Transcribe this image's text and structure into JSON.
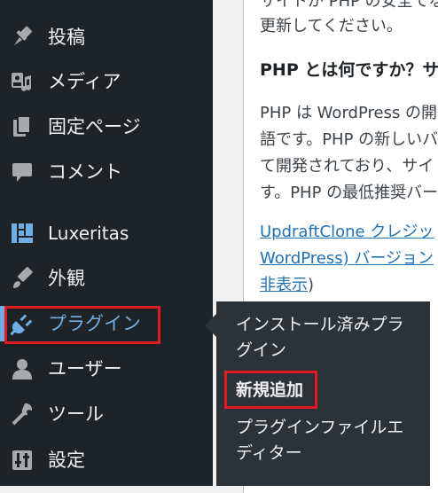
{
  "sidebar": {
    "items": [
      {
        "label": "投稿",
        "icon": "pushpin-icon"
      },
      {
        "label": "メディア",
        "icon": "media-icon"
      },
      {
        "label": "固定ページ",
        "icon": "pages-icon"
      },
      {
        "label": "コメント",
        "icon": "comment-icon"
      },
      {
        "label": "Luxeritas",
        "icon": "luxeritas-icon"
      },
      {
        "label": "外観",
        "icon": "paintbrush-icon"
      },
      {
        "label": "プラグイン",
        "icon": "plugin-icon",
        "active": true
      },
      {
        "label": "ユーザー",
        "icon": "user-icon"
      },
      {
        "label": "ツール",
        "icon": "wrench-icon"
      },
      {
        "label": "設定",
        "icon": "settings-icon"
      }
    ]
  },
  "submenu": {
    "installed": [
      "インストール済みプラ",
      "グイン"
    ],
    "add_new": "新規追加",
    "editor": [
      "プラグインファイルエ",
      "ディター"
    ]
  },
  "main": {
    "lines": [
      "サイトが PHP の安全でな",
      "更新してください。",
      "PHP とは何ですか？サ",
      "PHP は WordPress の開",
      "語です。PHP の新しいバ",
      "て開発されており、サイ",
      "す。PHP の最低推奨バー"
    ],
    "link_lines": [
      "UpdraftClone クレジッ",
      "WordPress) バージョン"
    ],
    "hide_link": "非表示",
    "hide_suffix": ")"
  },
  "colors": {
    "sidebar_bg": "#1d2327",
    "submenu_bg": "#2c3338",
    "active": "#72aee6",
    "highlight_box": "#e01b24",
    "link": "#2271b1"
  }
}
